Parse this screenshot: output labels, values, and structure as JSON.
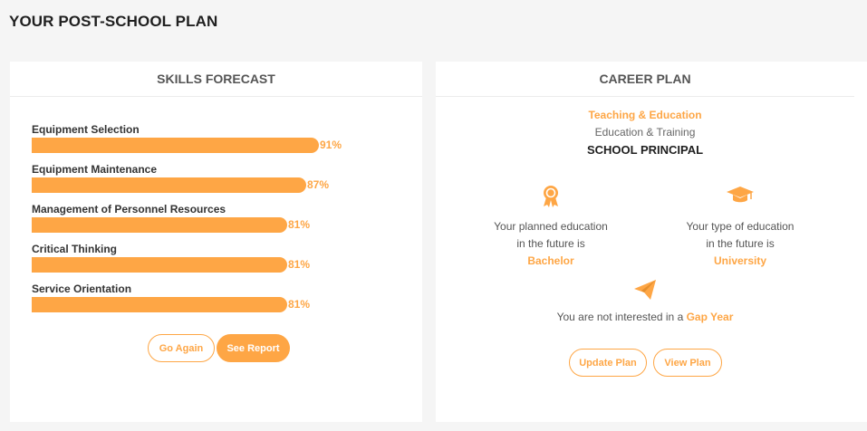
{
  "page": {
    "title": "YOUR POST-SCHOOL PLAN"
  },
  "skills": {
    "header": "SKILLS FORECAST",
    "items": [
      {
        "label": "Equipment Selection",
        "percent": 91,
        "percent_label": "91%"
      },
      {
        "label": "Equipment Maintenance",
        "percent": 87,
        "percent_label": "87%"
      },
      {
        "label": "Management of Personnel Resources",
        "percent": 81,
        "percent_label": "81%"
      },
      {
        "label": "Critical Thinking",
        "percent": 81,
        "percent_label": "81%"
      },
      {
        "label": "Service Orientation",
        "percent": 81,
        "percent_label": "81%"
      }
    ],
    "go_again_label": "Go Again",
    "see_report_label": "See Report"
  },
  "career": {
    "header": "CAREER PLAN",
    "industry": "Teaching & Education",
    "field": "Education & Training",
    "job": "SCHOOL PRINCIPAL",
    "planned_education": {
      "line1": "Your planned education",
      "line2": "in the future is",
      "value": "Bachelor",
      "icon": "award-ribbon-icon"
    },
    "type_education": {
      "line1": "Your type of education",
      "line2": "in the future is",
      "value": "University",
      "icon": "graduation-cap-icon"
    },
    "gap_year": {
      "text": "You are not interested in a",
      "highlight": "Gap Year",
      "icon": "paper-plane-icon"
    },
    "update_plan_label": "Update Plan",
    "view_plan_label": "View Plan"
  },
  "colors": {
    "accent": "#fea645",
    "background": "#f5f5f5"
  }
}
